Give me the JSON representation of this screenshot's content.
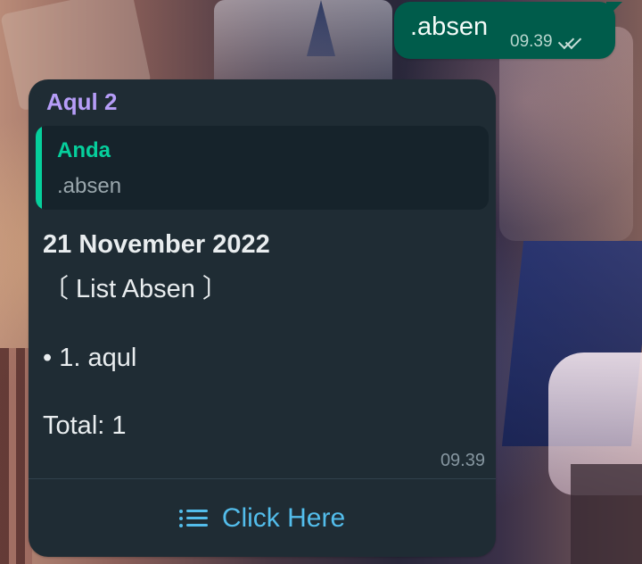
{
  "sent_message": {
    "text": ".absen",
    "time": "09.39",
    "status_icon": "double-check-icon"
  },
  "received_message": {
    "sender": "Aqul 2",
    "quoted": {
      "title": "Anda",
      "text": ".absen"
    },
    "body": {
      "date": "21 November 2022",
      "list_title": "〔 List Absen 〕",
      "entry": "• 1. aqul",
      "total": "Total: 1"
    },
    "time": "09.39",
    "button": {
      "label": "Click Here",
      "icon": "list-icon"
    }
  },
  "colors": {
    "sent_bubble": "#005c4b",
    "received_bubble": "#1f2c34",
    "quote_bar": "#06cf9c",
    "sender_name": "#b69df8",
    "link": "#53bdeb"
  }
}
